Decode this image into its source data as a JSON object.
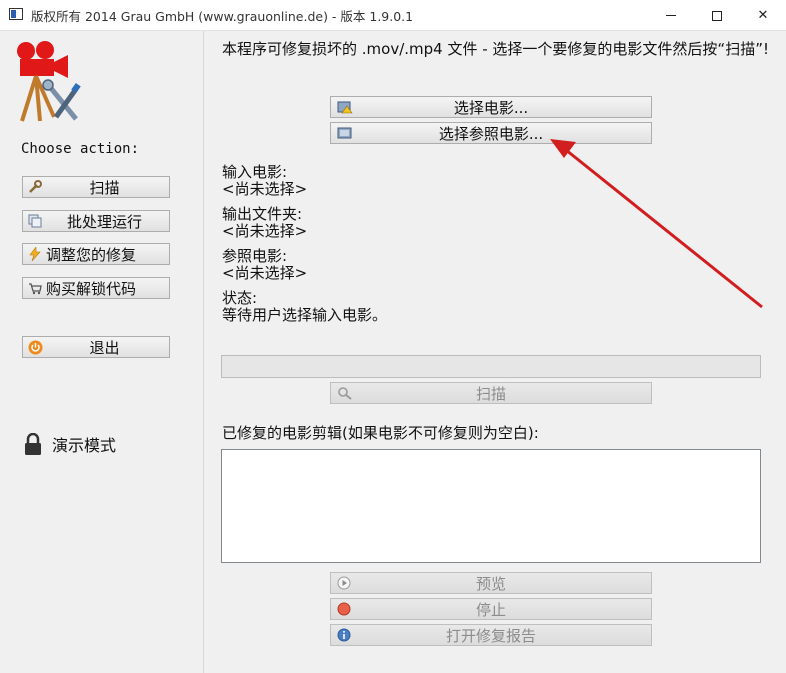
{
  "window": {
    "title": "版权所有 2014 Grau GmbH (www.grauonline.de) - 版本 1.9.0.1",
    "min_glyph": "—",
    "max_glyph": "☐",
    "close_glyph": "✕"
  },
  "sidebar": {
    "choose_label": "Choose action:",
    "buttons": [
      {
        "label": "扫描",
        "icon": "wrench-icon"
      },
      {
        "label": "批处理运行",
        "icon": "batch-icon"
      },
      {
        "label": "调整您的修复",
        "icon": "lightning-icon"
      },
      {
        "label": "购买解锁代码",
        "icon": "cart-icon"
      },
      {
        "label": "退出",
        "icon": "power-icon"
      }
    ],
    "demo_mode": "演示模式"
  },
  "main": {
    "info_text": "本程序可修复损坏的 .mov/.mp4 文件 - 选择一个要修复的电影文件然后按“扫描”!",
    "select_movie_button": "选择电影...",
    "select_reference_button": "选择参照电影...",
    "input_movie_label": "输入电影:",
    "input_movie_value": "<尚未选择>",
    "output_folder_label": "输出文件夹:",
    "output_folder_value": "<尚未选择>",
    "reference_movie_label": "参照电影:",
    "reference_movie_value": "<尚未选择>",
    "status_label": "状态:",
    "status_value": "等待用户选择输入电影。",
    "progress": 0,
    "scan_button": "扫描",
    "repaired_clips_label": "已修复的电影剪辑(如果电影不可修复则为空白):",
    "preview_button": "预览",
    "stop_button": "停止",
    "open_report_button": "打开修复报告"
  },
  "colors": {
    "accent_red": "#d62020",
    "arrow": "#d21e1e",
    "progress_fill": "#06b025"
  }
}
